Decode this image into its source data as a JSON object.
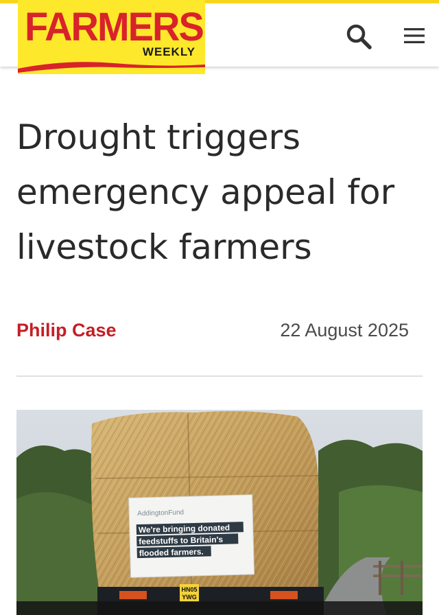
{
  "header": {
    "logo_main": "FARMERS",
    "logo_sub": "WEEKLY",
    "search_icon": "search-icon",
    "menu_icon": "hamburger-menu-icon"
  },
  "article": {
    "headline": "Drought triggers emergency appeal for livestock farmers",
    "author": "Philip Case",
    "date": "22 August 2025"
  },
  "hero_image": {
    "banner_brand": "AddingtonFund",
    "banner_line1": "We're bringing donated",
    "banner_line2": "feedstuffs to Britain's",
    "banner_line3": "flooded farmers.",
    "plate_line1": "HN05",
    "plate_line2": "YWG"
  },
  "colors": {
    "brand_red": "#c41f25",
    "brand_yellow": "#fde82b",
    "headline": "#2a2a2a",
    "date": "#4a4a4a"
  }
}
